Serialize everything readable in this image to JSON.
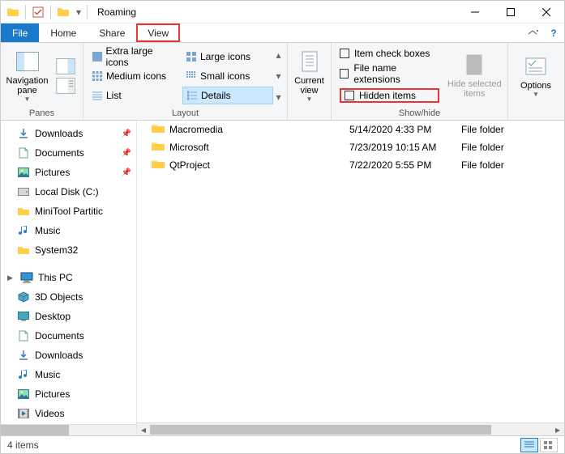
{
  "window": {
    "title": "Roaming"
  },
  "tabs": {
    "file": "File",
    "home": "Home",
    "share": "Share",
    "view": "View"
  },
  "ribbon": {
    "panes": {
      "nav": "Navigation\npane",
      "group": "Panes"
    },
    "layout": {
      "xl": "Extra large icons",
      "large": "Large icons",
      "medium": "Medium icons",
      "small": "Small icons",
      "list": "List",
      "details": "Details",
      "group": "Layout"
    },
    "current_view": {
      "label": "Current\nview",
      "group": ""
    },
    "showhide": {
      "checkboxes": "Item check boxes",
      "ext": "File name extensions",
      "hidden": "Hidden items",
      "hidesel": "Hide selected\nitems",
      "group": "Show/hide"
    },
    "options": {
      "label": "Options"
    }
  },
  "nav": {
    "downloads": "Downloads",
    "documents": "Documents",
    "pictures": "Pictures",
    "localdisk": "Local Disk (C:)",
    "minitool": "MiniTool Partitic",
    "music": "Music",
    "system32": "System32",
    "thispc": "This PC",
    "threed": "3D Objects",
    "desktop": "Desktop",
    "documents2": "Documents",
    "downloads2": "Downloads",
    "music2": "Music",
    "pictures2": "Pictures",
    "videos": "Videos"
  },
  "files": [
    {
      "name": "Macromedia",
      "date": "5/14/2020 4:33 PM",
      "type": "File folder"
    },
    {
      "name": "Microsoft",
      "date": "7/23/2019 10:15 AM",
      "type": "File folder"
    },
    {
      "name": "QtProject",
      "date": "7/22/2020 5:55 PM",
      "type": "File folder"
    }
  ],
  "status": {
    "count": "4 items"
  }
}
